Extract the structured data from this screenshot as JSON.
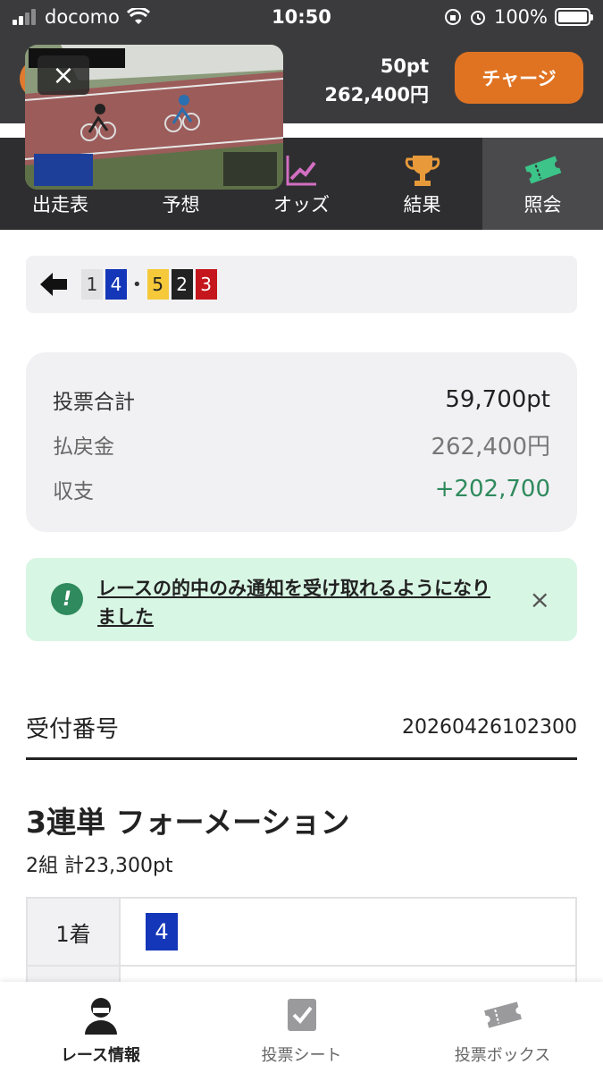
{
  "status_bar": {
    "carrier": "docomo",
    "time": "10:50",
    "battery": "100%"
  },
  "header": {
    "points": "50pt",
    "balance": "262,400円",
    "charge_label": "チャージ"
  },
  "tabs": [
    {
      "label": "出走表",
      "icon": "race-card-icon"
    },
    {
      "label": "予想",
      "icon": "prediction-icon"
    },
    {
      "label": "オッズ",
      "icon": "odds-chart-icon"
    },
    {
      "label": "結果",
      "icon": "trophy-icon"
    },
    {
      "label": "照会",
      "icon": "ticket-icon"
    }
  ],
  "active_tab": "照会",
  "video": {
    "close_label": "×"
  },
  "race": {
    "numbers": [
      {
        "n": "1",
        "color": "white"
      },
      {
        "n": "4",
        "color": "blue"
      },
      {
        "n": "5",
        "color": "yellow"
      },
      {
        "n": "2",
        "color": "black"
      },
      {
        "n": "3",
        "color": "red"
      }
    ],
    "separator": "•"
  },
  "summary": {
    "total_label": "投票合計",
    "total_value": "59,700pt",
    "payout_label": "払戻金",
    "payout_value": "262,400円",
    "balance_label": "収支",
    "balance_value": "+202,700"
  },
  "notice": {
    "icon": "!",
    "text": "レースの的中のみ通知を受け取れるようになりました",
    "close": "×"
  },
  "receipt": {
    "label": "受付番号",
    "value": "20260426102300"
  },
  "bet": {
    "title": "3連単 フォーメーション",
    "subtitle": "2組 計23,300pt",
    "rows": [
      {
        "head": "1着",
        "num": "4"
      }
    ]
  },
  "bottom_nav": [
    {
      "label": "レース情報",
      "icon": "racer-icon",
      "active": true
    },
    {
      "label": "投票シート",
      "icon": "vote-sheet-icon",
      "active": false
    },
    {
      "label": "投票ボックス",
      "icon": "ticket-box-icon",
      "active": false
    }
  ],
  "colors": {
    "accent": "#e07322",
    "positive": "#2f8a5d",
    "header_bg": "#3b3b3d",
    "notice_bg": "#d8f6e4"
  }
}
